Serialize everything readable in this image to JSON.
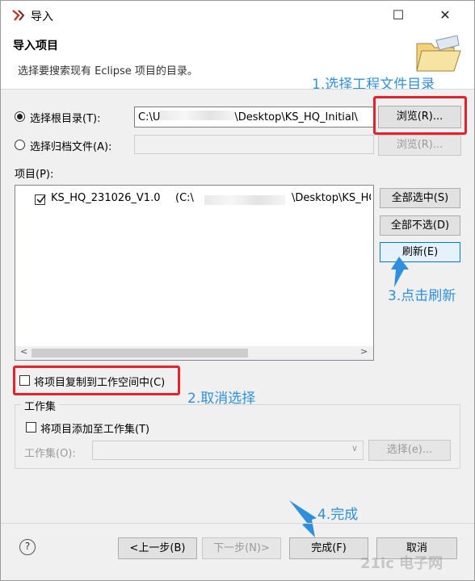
{
  "window": {
    "title": "导入"
  },
  "header": {
    "title": "导入项目",
    "description": "选择要搜索现有 Eclipse 项目的目录。"
  },
  "root_dir": {
    "label": "选择根目录(T):",
    "path_start": "C:\\U",
    "path_end": "\\Desktop\\KS_HQ_Initial\\",
    "browse_label": "浏览(R)..."
  },
  "archive": {
    "label": "选择归档文件(A):",
    "browse_label": "浏览(R)..."
  },
  "projects": {
    "label": "项目(P):",
    "items": [
      {
        "name": "KS_HQ_231026_V1.0",
        "path_start": "(C:\\",
        "path_end": "\\Desktop\\KS_HQ",
        "checked": true
      }
    ],
    "select_all": "全部选中(S)",
    "deselect_all": "全部不选(D)",
    "refresh": "刷新(E)"
  },
  "copy_option": {
    "label": "将项目复制到工作空间中(C)",
    "checked": false
  },
  "working_set": {
    "group_title": "工作集",
    "add_label": "将项目添加至工作集(T)",
    "field_label": "工作集(O):",
    "select_label": "选择(e)..."
  },
  "footer": {
    "help": "?",
    "back": "<上一步(B)",
    "next": "下一步(N)>",
    "finish": "完成(F)",
    "cancel": "取消"
  },
  "annotations": {
    "step1": "1.选择工程文件目录",
    "step2": "2.取消选择",
    "step3": "3.点击刷新",
    "step4": "4.完成"
  },
  "watermark": "21ic 电子网",
  "colors": {
    "annotation": "#2f8fdc",
    "highlight": "#e8202a",
    "focus": "#0078d7"
  }
}
